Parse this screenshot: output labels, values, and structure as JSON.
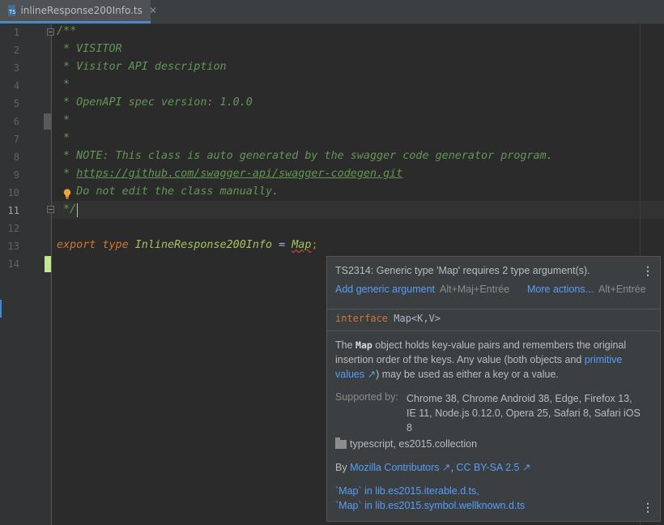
{
  "tab": {
    "filename": "inlineResponse200Info.ts",
    "icon": "ts-file-icon",
    "close": "✕"
  },
  "editor": {
    "line_numbers": [
      "1",
      "2",
      "3",
      "4",
      "5",
      "6",
      "7",
      "8",
      "9",
      "10",
      "11",
      "12",
      "13",
      "14"
    ],
    "current_line": "11",
    "lines": {
      "l1": "/**",
      "l2": " * VISITOR",
      "l3": " * Visitor API description",
      "l4": " *",
      "l5": " * OpenAPI spec version: 1.0.0",
      "l6": " *",
      "l7": " *",
      "l8": " * NOTE: This class is auto generated by the swagger code generator program.",
      "l9_prefix": " * ",
      "l9_link": "https://github.com/swagger-api/swagger-codegen.git",
      "l10": "   Do not edit the class manually.",
      "l11": " */",
      "l13_export": "export",
      "l13_type": "type",
      "l13_name": "InlineResponse200Info",
      "l13_eq": " = ",
      "l13_map": "Map",
      "l13_semi": ";"
    }
  },
  "popup": {
    "error": "TS2314: Generic type 'Map' requires 2 type argument(s).",
    "action1": "Add generic argument",
    "action1_shortcut": "Alt+Maj+Entrée",
    "action2": "More actions...",
    "action2_shortcut": "Alt+Entrée",
    "sig_keyword": "interface",
    "sig_rest": " Map<K,V>",
    "desc_1": "The ",
    "desc_bold": "Map",
    "desc_2": " object holds key-value pairs and remembers the original insertion order of the keys. Any value (both objects and ",
    "desc_link": "primitive values ↗",
    "desc_3": ") may be used as either a key or a value.",
    "supported_label": "Supported by:",
    "supported_value": "Chrome 38, Chrome Android 38, Edge, Firefox 13, IE 11, Node.js 0.12.0, Opera 25, Safari 8, Safari iOS 8",
    "module": "typescript, es2015.collection",
    "by_prefix": "By ",
    "by_link1": "Mozilla Contributors ↗",
    "by_sep": ", ",
    "by_link2": "CC BY-SA 2.5 ↗",
    "ref1": "`Map` in lib.es2015.iterable.d.ts,",
    "ref2": "`Map` in lib.es2015.symbol.wellknown.d.ts",
    "menu_glyph": "⋮"
  }
}
